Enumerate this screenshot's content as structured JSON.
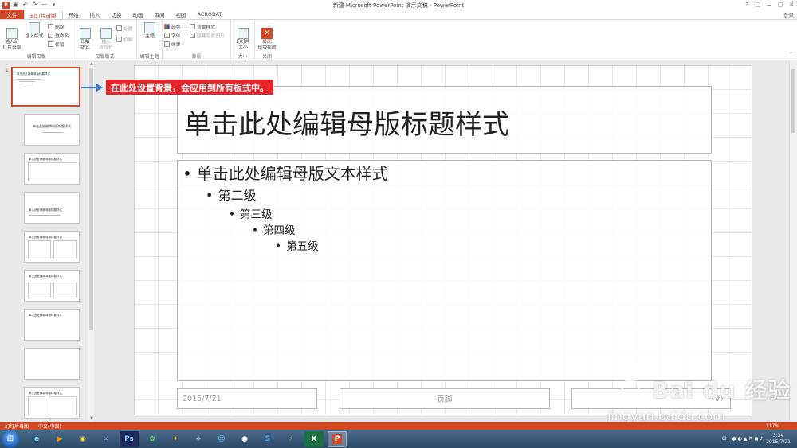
{
  "window": {
    "title": "新建 Microsoft PowerPoint 演示文稿 - PowerPoint",
    "signin": "登录",
    "controls": [
      "?",
      "▢",
      "—",
      "▢",
      "✕"
    ]
  },
  "qat": [
    "save",
    "undo",
    "redo",
    "start"
  ],
  "tabs": [
    {
      "label": "文件"
    },
    {
      "label": "幻灯片母版"
    },
    {
      "label": "开始"
    },
    {
      "label": "插入"
    },
    {
      "label": "切换"
    },
    {
      "label": "动画"
    },
    {
      "label": "审阅"
    },
    {
      "label": "视图"
    },
    {
      "label": "ACROBAT"
    }
  ],
  "ribbon": {
    "edit_master": {
      "label": "编辑母版",
      "insert_master": "插入幻\n灯片母版",
      "insert_layout": "插入版式",
      "delete": "删除",
      "rename": "重命名",
      "preserve": "保留"
    },
    "master_layout": {
      "label": "母版版式",
      "master_layout_btn": "母版\n版式",
      "insert_placeholder": "插入\n占位符",
      "title": "标题",
      "footer": "页脚"
    },
    "edit_theme": {
      "label": "编辑主题",
      "theme": "主题"
    },
    "background": {
      "label": "背景",
      "colors": "颜色",
      "fonts": "字体",
      "effects": "效果",
      "bg_styles": "背景样式",
      "hide_bg": "隐藏背景图形"
    },
    "size": {
      "label": "大小",
      "slide_size": "幻灯片\n大小"
    },
    "close": {
      "label": "关闭",
      "close_master": "关闭\n母版视图"
    }
  },
  "thumbnails": {
    "number": "1",
    "master_title": "单击此处编辑母版标题样式",
    "layouts": [
      "单击此处编辑母版标题样式",
      "单击此处编辑母版标题样式",
      "单击此处编辑母版标题样式",
      "单击此处编辑母版标题样式",
      "单击此处编辑母版标题样式",
      "单击此处编辑母版标题样式",
      "",
      "单击此处编辑母版标题样式"
    ]
  },
  "callout": "在此处设置背景，会应用到所有板式中。",
  "slide": {
    "title": "单击此处编辑母版标题样式",
    "levels": [
      "单击此处编辑母版文本样式",
      "第二级",
      "第三级",
      "第四级",
      "第五级"
    ],
    "date": "2015/7/21",
    "footer": "页脚",
    "number": "‹#›"
  },
  "status": {
    "view": "幻灯片母版",
    "language": "中文(中国)",
    "zoom": "117%"
  },
  "taskbar": {
    "time": "3:34",
    "date": "2015/7/21",
    "tray_text": "CH"
  },
  "watermark": {
    "brand": "Bai du 经验",
    "site": "jingyan.baidu.com"
  }
}
